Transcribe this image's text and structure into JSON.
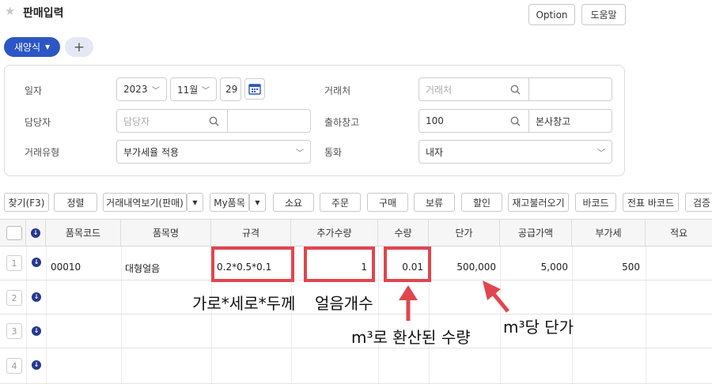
{
  "header": {
    "title": "판매입력",
    "option_label": "Option",
    "help_label": "도움말"
  },
  "tabs": {
    "active_label": "새양식",
    "add_label": "+"
  },
  "form": {
    "date": {
      "label": "일자",
      "year": "2023",
      "month": "11월",
      "day": "29"
    },
    "customer": {
      "label": "거래처",
      "placeholder": "거래처"
    },
    "manager": {
      "label": "담당자",
      "placeholder": "담당자"
    },
    "warehouse": {
      "label": "출하창고",
      "code": "100",
      "name": "본사창고"
    },
    "trade_type": {
      "label": "거래유형",
      "value": "부가세율 적용"
    },
    "currency": {
      "label": "통화",
      "value": "내자"
    }
  },
  "toolbar": {
    "find": "찾기(F3)",
    "sort": "정렬",
    "history": "거래내역보기(판매)",
    "my_items": "My품목",
    "consume": "소요",
    "order": "주문",
    "purchase": "구매",
    "hold": "보류",
    "discount": "할인",
    "restock": "재고불러오기",
    "barcode": "바코드",
    "slip_barcode": "전표 바코드",
    "verify": "검증"
  },
  "grid": {
    "columns": [
      "품목코드",
      "품목명",
      "규격",
      "추가수량",
      "수량",
      "단가",
      "공급가액",
      "부가세",
      "적요"
    ],
    "rows": [
      {
        "num": "1",
        "code": "00010",
        "name": "대형얼음",
        "spec": "0.2*0.5*0.1",
        "extra_qty": "1",
        "qty": "0.01",
        "unit_price": "500,000",
        "supply": "5,000",
        "vat": "500"
      },
      {
        "num": "2"
      },
      {
        "num": "3"
      },
      {
        "num": "4"
      }
    ]
  },
  "annotations": {
    "spec_note": "가로*세로*두께",
    "extra_qty_note": "얼음개수",
    "qty_note": "m³로 환산된 수량",
    "price_note": "m³당 단가"
  },
  "colors": {
    "accent": "#2b56c4",
    "highlight": "#e0464f",
    "row_arrow": "#27388f"
  }
}
